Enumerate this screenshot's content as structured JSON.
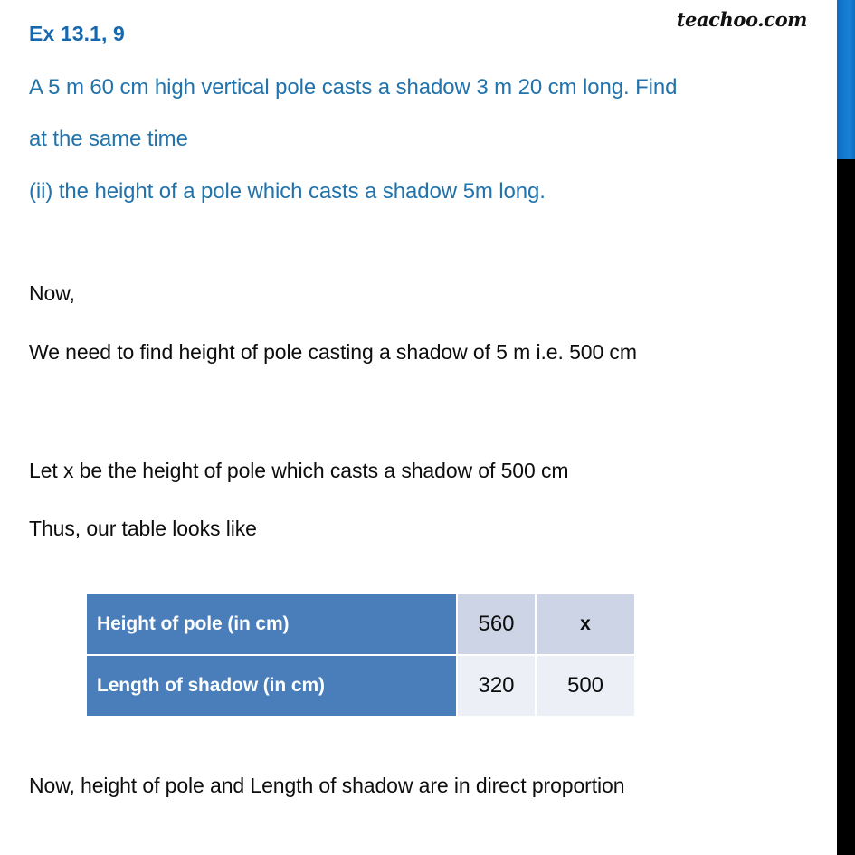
{
  "branding": {
    "logo_text": "teachoo.com"
  },
  "question": {
    "heading": "Ex 13.1, 9",
    "lines": [
      "A 5 m 60 cm high vertical pole casts a shadow 3 m 20 cm long. Find",
      "at the same time",
      "(ii) the height of a pole which casts a shadow 5m long."
    ]
  },
  "solution": {
    "lines": [
      "Now,",
      "We need to find height of pole casting a shadow of 5 m i.e. 500 cm",
      "Let x be the height of pole which casts a shadow of 500 cm",
      "Thus, our table looks like",
      "Now, height of pole and Length of shadow are in direct proportion"
    ]
  },
  "table": {
    "rows": [
      {
        "label": "Height of pole (in cm)",
        "value1": "560",
        "value2": "x"
      },
      {
        "label": "Length of shadow (in cm)",
        "value1": "320",
        "value2": "500"
      }
    ]
  },
  "colors": {
    "heading_blue": "#1668ae",
    "question_blue": "#2273ac",
    "table_header_blue": "#4a7ebb",
    "table_row1_cell": "#ccd4e5",
    "table_row2_cell": "#eceff6",
    "scrollbar_thumb": "#1279cd",
    "scrollbar_track": "#000000"
  },
  "scrollbar": {
    "position_label": "top"
  }
}
